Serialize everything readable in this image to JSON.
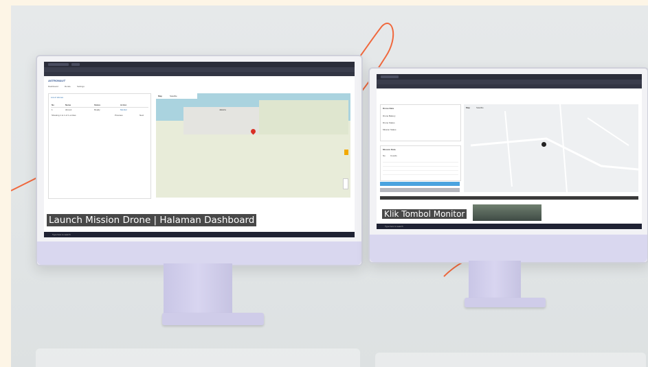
{
  "left_screen": {
    "logo": "ASTRONAUT",
    "nav": [
      "Dashboard",
      "Ronde",
      "Settings"
    ],
    "list": {
      "title": "List of drones",
      "columns": [
        "No",
        "Name",
        "Status",
        "Action"
      ],
      "row": [
        "1",
        "drone1",
        "Ready",
        "Monitor"
      ],
      "footer": "Showing 1 to 1 of 1 entries",
      "prev": "Previous",
      "next": "Next"
    },
    "map": {
      "tabs": [
        "Map",
        "Satellite"
      ],
      "city": "Jakarta"
    },
    "caption": "Launch Mission Drone | Halaman Dashboard",
    "taskbar_search": "Type here to search"
  },
  "right_screen": {
    "drone_data": {
      "title": "Drone Data",
      "rows": [
        "Drone Battery",
        "Drone Status",
        "Mission Status"
      ]
    },
    "mission_data": {
      "title": "Mission Data",
      "columns": [
        "No",
        "Coords"
      ]
    },
    "map": {
      "tabs": [
        "Map",
        "Satellite"
      ]
    },
    "caption": "Klik Tombol Monitor",
    "taskbar_search": "Type here to search"
  }
}
